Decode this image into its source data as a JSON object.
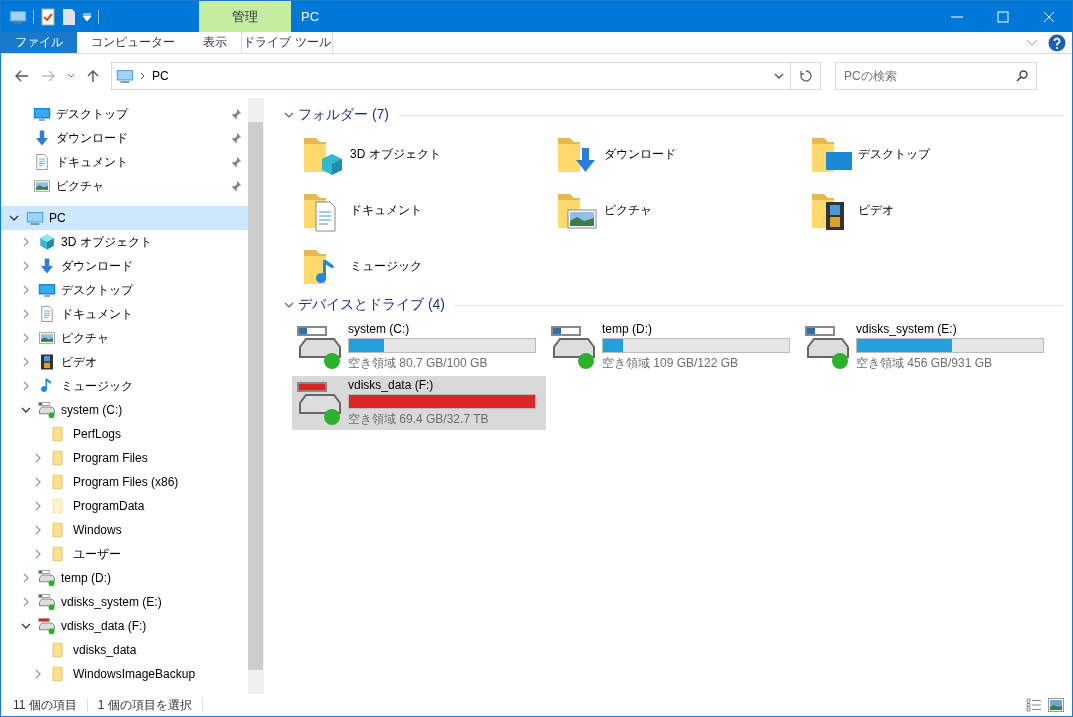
{
  "window": {
    "title": "PC",
    "context_tab": "管理"
  },
  "ribbon_tabs": [
    {
      "label": "ファイル",
      "selected": false,
      "kind": "file"
    },
    {
      "label": "コンピューター",
      "selected": false,
      "kind": "normal"
    },
    {
      "label": "表示",
      "selected": false,
      "kind": "normal"
    },
    {
      "label": "ドライブ ツール",
      "selected": false,
      "kind": "context"
    }
  ],
  "address": {
    "path": "PC",
    "search_placeholder": "PCの検索"
  },
  "quick_access": [
    {
      "label": "デスクトップ",
      "kind": "desktop",
      "pinned": true
    },
    {
      "label": "ダウンロード",
      "kind": "download",
      "pinned": true
    },
    {
      "label": "ドキュメント",
      "kind": "document",
      "pinned": true
    },
    {
      "label": "ピクチャ",
      "kind": "picture",
      "pinned": true
    }
  ],
  "tree": [
    {
      "label": "PC",
      "kind": "pc",
      "expandable": true,
      "expanded": true,
      "selected": true,
      "children": [
        {
          "label": "3D オブジェクト",
          "kind": "cube",
          "expandable": true,
          "expanded": false,
          "selected": false
        },
        {
          "label": "ダウンロード",
          "kind": "download",
          "expandable": true,
          "expanded": false,
          "selected": false
        },
        {
          "label": "デスクトップ",
          "kind": "desktop",
          "expandable": true,
          "expanded": false,
          "selected": false
        },
        {
          "label": "ドキュメント",
          "kind": "document",
          "expandable": true,
          "expanded": false,
          "selected": false
        },
        {
          "label": "ピクチャ",
          "kind": "picture",
          "expandable": true,
          "expanded": false,
          "selected": false
        },
        {
          "label": "ビデオ",
          "kind": "video",
          "expandable": true,
          "expanded": false,
          "selected": false
        },
        {
          "label": "ミュージック",
          "kind": "music",
          "expandable": true,
          "expanded": false,
          "selected": false
        },
        {
          "label": "system (C:)",
          "kind": "drive",
          "expandable": true,
          "expanded": true,
          "selected": false,
          "children": [
            {
              "label": "PerfLogs",
              "kind": "folder",
              "expandable": false,
              "selected": false
            },
            {
              "label": "Program Files",
              "kind": "folder",
              "expandable": true,
              "expanded": false,
              "selected": false
            },
            {
              "label": "Program Files (x86)",
              "kind": "folder",
              "expandable": true,
              "expanded": false,
              "selected": false
            },
            {
              "label": "ProgramData",
              "kind": "hidden",
              "expandable": true,
              "expanded": false,
              "selected": false
            },
            {
              "label": "Windows",
              "kind": "folder",
              "expandable": true,
              "expanded": false,
              "selected": false
            },
            {
              "label": "ユーザー",
              "kind": "folder",
              "expandable": true,
              "expanded": false,
              "selected": false
            }
          ]
        },
        {
          "label": "temp (D:)",
          "kind": "drive",
          "expandable": true,
          "expanded": false,
          "selected": false
        },
        {
          "label": "vdisks_system (E:)",
          "kind": "drive",
          "expandable": true,
          "expanded": false,
          "selected": false
        },
        {
          "label": "vdisks_data (F:)",
          "kind": "full",
          "expandable": true,
          "expanded": true,
          "selected": false,
          "children": [
            {
              "label": "vdisks_data",
              "kind": "folder",
              "expandable": false,
              "selected": false
            },
            {
              "label": "WindowsImageBackup",
              "kind": "folder",
              "expandable": true,
              "expanded": false,
              "selected": false
            }
          ]
        }
      ]
    }
  ],
  "folders": {
    "title": "フォルダー (7)",
    "expanded": true,
    "items": [
      {
        "label": "3D オブジェクト",
        "kind": "cube"
      },
      {
        "label": "ダウンロード",
        "kind": "download"
      },
      {
        "label": "デスクトップ",
        "kind": "desktop"
      },
      {
        "label": "ドキュメント",
        "kind": "document"
      },
      {
        "label": "ピクチャ",
        "kind": "picture"
      },
      {
        "label": "ビデオ",
        "kind": "video"
      },
      {
        "label": "ミュージック",
        "kind": "music"
      }
    ]
  },
  "drives": {
    "title": "デバイスとドライブ (4)",
    "expanded": true,
    "items": [
      {
        "name": "system (C:)",
        "free": "空き領域 80.7 GB/100 GB",
        "level": 0.19,
        "low_space": false,
        "selected": false
      },
      {
        "name": "temp (D:)",
        "free": "空き領域 109 GB/122 GB",
        "level": 0.11,
        "low_space": false,
        "selected": false
      },
      {
        "name": "vdisks_system (E:)",
        "free": "空き領域 456 GB/931 GB",
        "level": 0.51,
        "low_space": false,
        "selected": false
      },
      {
        "name": "vdisks_data (F:)",
        "free": "空き領域 69.4 GB/32.7 TB",
        "level": 0.998,
        "low_space": true,
        "selected": true
      }
    ]
  },
  "status_bar": {
    "item_count": "11 個の項目",
    "selection": "1 個の項目を選択"
  }
}
